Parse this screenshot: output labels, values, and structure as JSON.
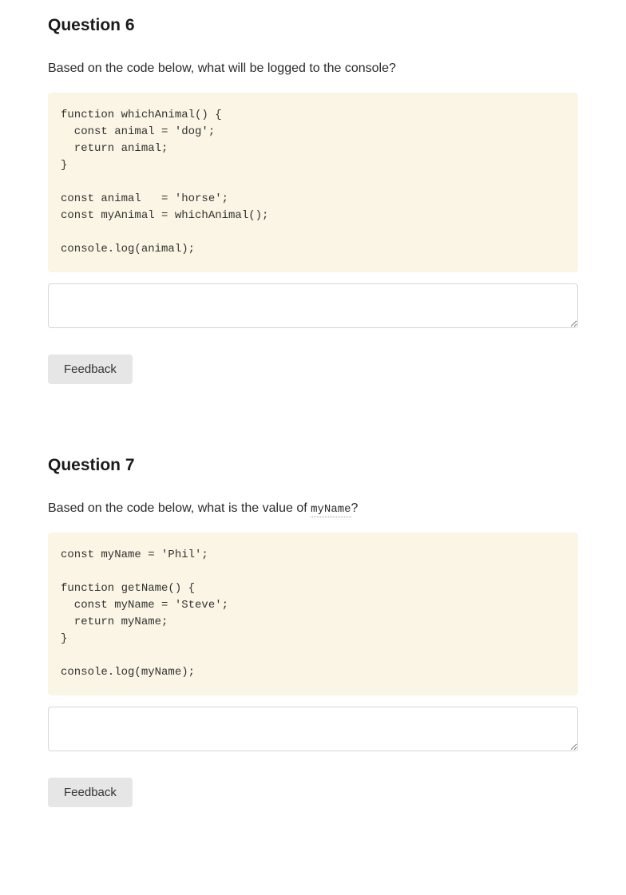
{
  "questions": [
    {
      "title": "Question 6",
      "prompt_prefix": "Based on the code below, what will be logged to the console?",
      "prompt_code": "",
      "prompt_suffix": "",
      "code": "function whichAnimal() {\n  const animal = 'dog';\n  return animal;\n}\n\nconst animal   = 'horse';\nconst myAnimal = whichAnimal();\n\nconsole.log(animal);",
      "answer_value": "",
      "feedback_label": "Feedback"
    },
    {
      "title": "Question 7",
      "prompt_prefix": "Based on the code below, what is the value of ",
      "prompt_code": "myName",
      "prompt_suffix": "?",
      "code": "const myName = 'Phil';\n\nfunction getName() {\n  const myName = 'Steve';\n  return myName;\n}\n\nconsole.log(myName);",
      "answer_value": "",
      "feedback_label": "Feedback"
    }
  ]
}
